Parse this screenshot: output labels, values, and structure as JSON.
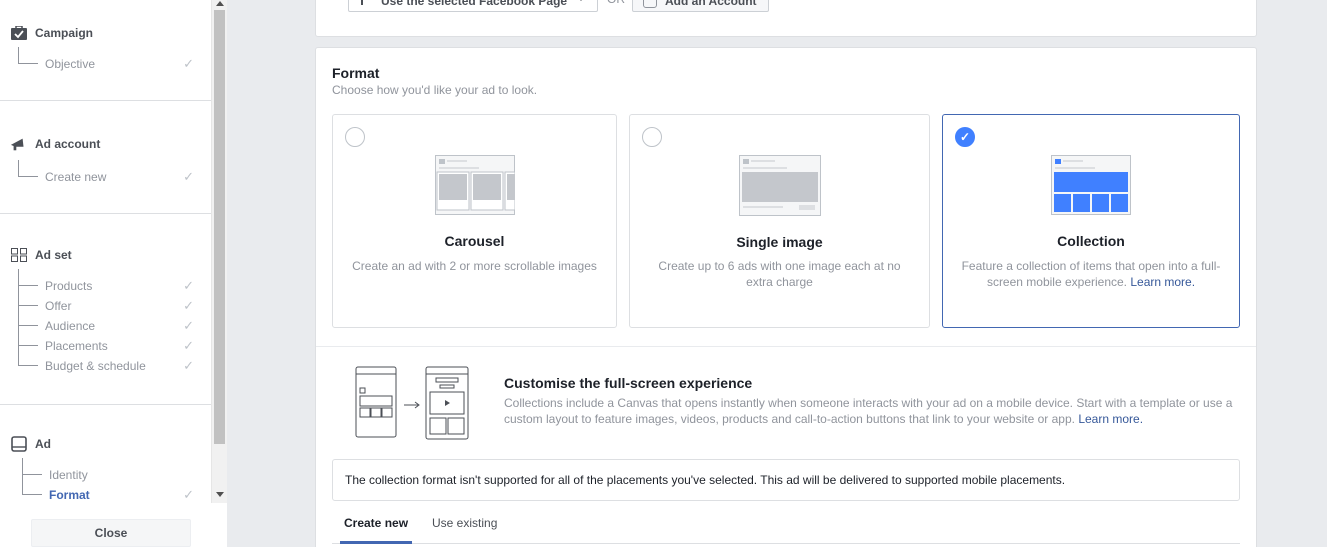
{
  "sidebar": {
    "campaign": {
      "heading": "Campaign",
      "icon": "briefcase-check-icon",
      "items": [
        {
          "label": "Objective",
          "done": true
        }
      ]
    },
    "ad_account": {
      "heading": "Ad account",
      "icon": "megaphone-icon",
      "items": [
        {
          "label": "Create new",
          "done": true
        }
      ]
    },
    "ad_set": {
      "heading": "Ad set",
      "icon": "grid-icon",
      "items": [
        {
          "label": "Products",
          "done": true
        },
        {
          "label": "Offer",
          "done": true
        },
        {
          "label": "Audience",
          "done": true
        },
        {
          "label": "Placements",
          "done": true
        },
        {
          "label": "Budget & schedule",
          "done": true
        }
      ]
    },
    "ad": {
      "heading": "Ad",
      "icon": "tablet-icon",
      "items": [
        {
          "label": "Identity",
          "done": false
        },
        {
          "label": "Format",
          "done": true,
          "active": true
        }
      ]
    },
    "check_glyph": "✓",
    "close_label": "Close"
  },
  "identity_bar": {
    "page_button_label": "Use the selected Facebook Page",
    "or_text": "OR",
    "add_account_label": "Add an Account"
  },
  "format": {
    "title": "Format",
    "subtitle": "Choose how you'd like your ad to look.",
    "options": [
      {
        "name": "Carousel",
        "description": "Create an ad with 2 or more scrollable images",
        "selected": false
      },
      {
        "name": "Single image",
        "description": "Create up to 6 ads with one image each at no extra charge",
        "selected": false
      },
      {
        "name": "Collection",
        "description": "Feature a collection of items that open into a full-screen mobile experience.",
        "learn_more": "Learn more.",
        "selected": true
      }
    ],
    "selected_check": "✓"
  },
  "customise": {
    "title": "Customise the full-screen experience",
    "description": "Collections include a Canvas that opens instantly when someone interacts with your ad on a mobile device. Start with a template or use a custom layout to feature images, videos, products and call-to-action buttons that link to your website or app.",
    "learn_more": "Learn more.",
    "arrow": "→"
  },
  "notice": "The collection format isn't supported for all of the placements you've selected. This ad will be delivered to supported mobile placements.",
  "tabs": [
    {
      "label": "Create new",
      "active": true
    },
    {
      "label": "Use existing",
      "active": false
    }
  ],
  "colors": {
    "accent": "#4267b2",
    "selected_radio": "#4080ff",
    "link": "#365899",
    "muted_text": "#90949c"
  }
}
